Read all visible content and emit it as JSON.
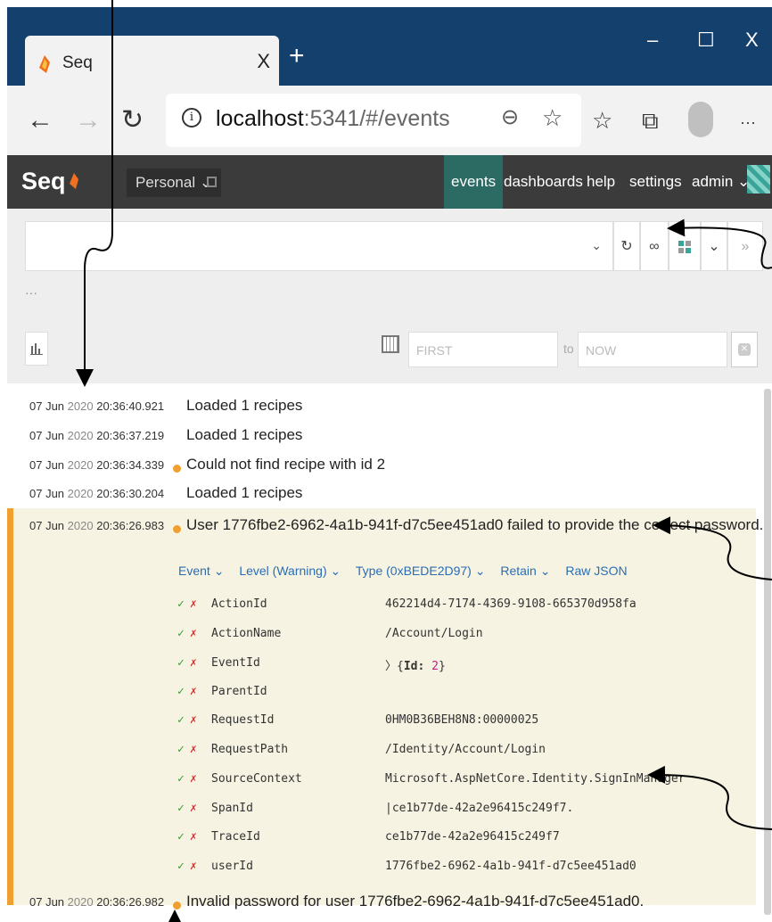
{
  "browser": {
    "tab_title": "Seq",
    "tab_close": "X",
    "new_tab": "+",
    "window_controls": [
      "–",
      "☐",
      "X"
    ],
    "address_host": "localhost",
    "address_rest": ":5341/#/events",
    "more": "···",
    "icons": [
      "back-icon",
      "forward-icon",
      "refresh-icon",
      "info-icon",
      "zoom-icon",
      "favorite-icon",
      "favorites-list-icon",
      "collections-icon",
      "profile-icon"
    ]
  },
  "seq": {
    "logo": "Seq",
    "workspace": "Personal ⌄",
    "nav": [
      "events",
      "dashboards",
      "help",
      "settings",
      "admin ⌄"
    ],
    "active_nav": "events",
    "accent": "#2c6b63"
  },
  "filter": {
    "search_caret": "⌄",
    "more": "···",
    "from_placeholder": "FIRST",
    "to_label": "to",
    "to_placeholder": "NOW",
    "button_icons": [
      "refresh-icon",
      "tail-icon",
      "signal-icon",
      "dropdown-icon",
      "collapse-icon"
    ]
  },
  "events": [
    {
      "date": "07 Jun",
      "year": "2020",
      "time": "20:36:40.921",
      "message": "Loaded 1 recipes",
      "level": "info"
    },
    {
      "date": "07 Jun",
      "year": "2020",
      "time": "20:36:37.219",
      "message": "Loaded 1 recipes",
      "level": "info"
    },
    {
      "date": "07 Jun",
      "year": "2020",
      "time": "20:36:34.339",
      "message": "Could not find recipe with id 2",
      "level": "warning"
    },
    {
      "date": "07 Jun",
      "year": "2020",
      "time": "20:36:30.204",
      "message": "Loaded 1 recipes",
      "level": "info"
    },
    {
      "date": "07 Jun",
      "year": "2020",
      "time": "20:36:26.983",
      "message": "User 1776fbe2-6962-4a1b-941f-d7c5ee451ad0 failed to provide the correct password.",
      "level": "warning"
    },
    {
      "date": "07 Jun",
      "year": "2020",
      "time": "20:36:26.982",
      "message": "Invalid password for user 1776fbe2-6962-4a1b-941f-d7c5ee451ad0.",
      "level": "warning"
    }
  ],
  "detail": {
    "actions": [
      "Event ⌄",
      "Level (Warning) ⌄",
      "Type (0xBEDE2D97) ⌄",
      "Retain ⌄",
      "Raw JSON"
    ],
    "check": "✓",
    "cross": "✗",
    "properties": [
      {
        "name": "ActionId",
        "value": "462214d4-7174-4369-9108-665370d958fa"
      },
      {
        "name": "ActionName",
        "value": "/Account/Login"
      },
      {
        "name": "EventId",
        "value": ""
      },
      {
        "name": "ParentId",
        "value": ""
      },
      {
        "name": "RequestId",
        "value": "0HM0B36BEH8N8:00000025"
      },
      {
        "name": "RequestPath",
        "value": "/Identity/Account/Login"
      },
      {
        "name": "SourceContext",
        "value": "Microsoft.AspNetCore.Identity.SignInManager"
      },
      {
        "name": "SpanId",
        "value": "|ce1b77de-42a2e96415c249f7."
      },
      {
        "name": "TraceId",
        "value": "ce1b77de-42a2e96415c249f7"
      },
      {
        "name": "userId",
        "value": "1776fbe2-6962-4a1b-941f-d7c5ee451ad0"
      }
    ],
    "eventid_prefix": "〉{",
    "eventid_key": "Id",
    "eventid_colon": ": ",
    "eventid_value": "2",
    "eventid_suffix": "}"
  },
  "colors": {
    "warning": "#f0a030",
    "titlebar": "#14406e",
    "navbar": "#3b3b3b",
    "highlight": "#f6f3e2"
  }
}
